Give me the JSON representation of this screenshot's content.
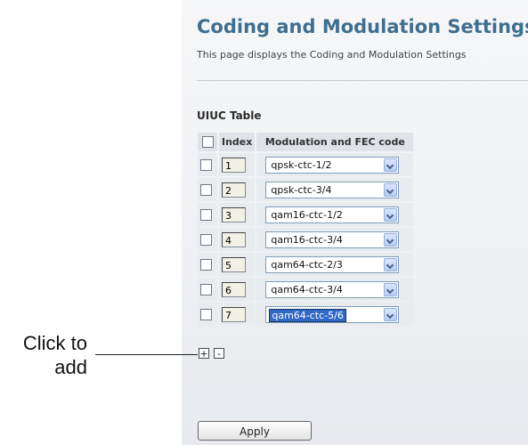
{
  "page": {
    "title": "Coding and Modulation Settings",
    "subtitle": "This page displays the Coding and Modulation Settings"
  },
  "table": {
    "title": "UIUC Table",
    "headers": {
      "index": "Index",
      "modulation": "Modulation and FEC code"
    },
    "rows": [
      {
        "index": "1",
        "modulation": "qpsk-ctc-1/2"
      },
      {
        "index": "2",
        "modulation": "qpsk-ctc-3/4"
      },
      {
        "index": "3",
        "modulation": "qam16-ctc-1/2"
      },
      {
        "index": "4",
        "modulation": "qam16-ctc-3/4"
      },
      {
        "index": "5",
        "modulation": "qam64-ctc-2/3"
      },
      {
        "index": "6",
        "modulation": "qam64-ctc-3/4"
      },
      {
        "index": "7",
        "modulation": "qam64-ctc-5/6"
      }
    ],
    "add_label": "+",
    "remove_label": "-"
  },
  "callout": {
    "line1": "Click to",
    "line2": "add"
  },
  "apply_label": "Apply",
  "colors": {
    "title": "#3f6f8f",
    "selection": "#3169c6"
  }
}
